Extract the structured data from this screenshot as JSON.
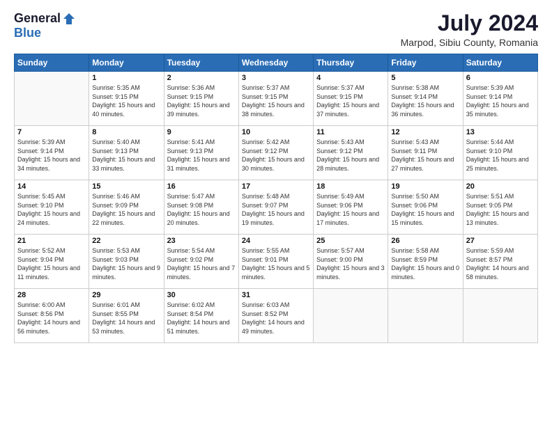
{
  "logo": {
    "general": "General",
    "blue": "Blue"
  },
  "title": {
    "month_year": "July 2024",
    "location": "Marpod, Sibiu County, Romania"
  },
  "weekdays": [
    "Sunday",
    "Monday",
    "Tuesday",
    "Wednesday",
    "Thursday",
    "Friday",
    "Saturday"
  ],
  "weeks": [
    [
      {
        "day": "",
        "info": ""
      },
      {
        "day": "1",
        "info": "Sunrise: 5:35 AM\nSunset: 9:15 PM\nDaylight: 15 hours\nand 40 minutes."
      },
      {
        "day": "2",
        "info": "Sunrise: 5:36 AM\nSunset: 9:15 PM\nDaylight: 15 hours\nand 39 minutes."
      },
      {
        "day": "3",
        "info": "Sunrise: 5:37 AM\nSunset: 9:15 PM\nDaylight: 15 hours\nand 38 minutes."
      },
      {
        "day": "4",
        "info": "Sunrise: 5:37 AM\nSunset: 9:15 PM\nDaylight: 15 hours\nand 37 minutes."
      },
      {
        "day": "5",
        "info": "Sunrise: 5:38 AM\nSunset: 9:14 PM\nDaylight: 15 hours\nand 36 minutes."
      },
      {
        "day": "6",
        "info": "Sunrise: 5:39 AM\nSunset: 9:14 PM\nDaylight: 15 hours\nand 35 minutes."
      }
    ],
    [
      {
        "day": "7",
        "info": "Sunrise: 5:39 AM\nSunset: 9:14 PM\nDaylight: 15 hours\nand 34 minutes."
      },
      {
        "day": "8",
        "info": "Sunrise: 5:40 AM\nSunset: 9:13 PM\nDaylight: 15 hours\nand 33 minutes."
      },
      {
        "day": "9",
        "info": "Sunrise: 5:41 AM\nSunset: 9:13 PM\nDaylight: 15 hours\nand 31 minutes."
      },
      {
        "day": "10",
        "info": "Sunrise: 5:42 AM\nSunset: 9:12 PM\nDaylight: 15 hours\nand 30 minutes."
      },
      {
        "day": "11",
        "info": "Sunrise: 5:43 AM\nSunset: 9:12 PM\nDaylight: 15 hours\nand 28 minutes."
      },
      {
        "day": "12",
        "info": "Sunrise: 5:43 AM\nSunset: 9:11 PM\nDaylight: 15 hours\nand 27 minutes."
      },
      {
        "day": "13",
        "info": "Sunrise: 5:44 AM\nSunset: 9:10 PM\nDaylight: 15 hours\nand 25 minutes."
      }
    ],
    [
      {
        "day": "14",
        "info": "Sunrise: 5:45 AM\nSunset: 9:10 PM\nDaylight: 15 hours\nand 24 minutes."
      },
      {
        "day": "15",
        "info": "Sunrise: 5:46 AM\nSunset: 9:09 PM\nDaylight: 15 hours\nand 22 minutes."
      },
      {
        "day": "16",
        "info": "Sunrise: 5:47 AM\nSunset: 9:08 PM\nDaylight: 15 hours\nand 20 minutes."
      },
      {
        "day": "17",
        "info": "Sunrise: 5:48 AM\nSunset: 9:07 PM\nDaylight: 15 hours\nand 19 minutes."
      },
      {
        "day": "18",
        "info": "Sunrise: 5:49 AM\nSunset: 9:06 PM\nDaylight: 15 hours\nand 17 minutes."
      },
      {
        "day": "19",
        "info": "Sunrise: 5:50 AM\nSunset: 9:06 PM\nDaylight: 15 hours\nand 15 minutes."
      },
      {
        "day": "20",
        "info": "Sunrise: 5:51 AM\nSunset: 9:05 PM\nDaylight: 15 hours\nand 13 minutes."
      }
    ],
    [
      {
        "day": "21",
        "info": "Sunrise: 5:52 AM\nSunset: 9:04 PM\nDaylight: 15 hours\nand 11 minutes."
      },
      {
        "day": "22",
        "info": "Sunrise: 5:53 AM\nSunset: 9:03 PM\nDaylight: 15 hours\nand 9 minutes."
      },
      {
        "day": "23",
        "info": "Sunrise: 5:54 AM\nSunset: 9:02 PM\nDaylight: 15 hours\nand 7 minutes."
      },
      {
        "day": "24",
        "info": "Sunrise: 5:55 AM\nSunset: 9:01 PM\nDaylight: 15 hours\nand 5 minutes."
      },
      {
        "day": "25",
        "info": "Sunrise: 5:57 AM\nSunset: 9:00 PM\nDaylight: 15 hours\nand 3 minutes."
      },
      {
        "day": "26",
        "info": "Sunrise: 5:58 AM\nSunset: 8:59 PM\nDaylight: 15 hours\nand 0 minutes."
      },
      {
        "day": "27",
        "info": "Sunrise: 5:59 AM\nSunset: 8:57 PM\nDaylight: 14 hours\nand 58 minutes."
      }
    ],
    [
      {
        "day": "28",
        "info": "Sunrise: 6:00 AM\nSunset: 8:56 PM\nDaylight: 14 hours\nand 56 minutes."
      },
      {
        "day": "29",
        "info": "Sunrise: 6:01 AM\nSunset: 8:55 PM\nDaylight: 14 hours\nand 53 minutes."
      },
      {
        "day": "30",
        "info": "Sunrise: 6:02 AM\nSunset: 8:54 PM\nDaylight: 14 hours\nand 51 minutes."
      },
      {
        "day": "31",
        "info": "Sunrise: 6:03 AM\nSunset: 8:52 PM\nDaylight: 14 hours\nand 49 minutes."
      },
      {
        "day": "",
        "info": ""
      },
      {
        "day": "",
        "info": ""
      },
      {
        "day": "",
        "info": ""
      }
    ]
  ]
}
